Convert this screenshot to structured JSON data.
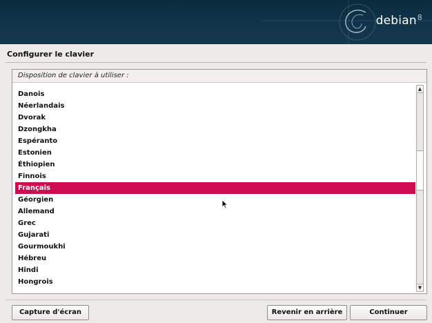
{
  "header": {
    "brand": "debian",
    "version": "8"
  },
  "page": {
    "title": "Configurer le clavier"
  },
  "keyboard_list": {
    "label": "Disposition de clavier à utiliser :",
    "items": [
      "Danois",
      "Néerlandais",
      "Dvorak",
      "Dzongkha",
      "Espéranto",
      "Estonien",
      "Éthiopien",
      "Finnois",
      "Français",
      "Géorgien",
      "Allemand",
      "Grec",
      "Gujarati",
      "Gourmoukhi",
      "Hébreu",
      "Hindi",
      "Hongrois"
    ],
    "selected": "Français",
    "scroll_position": 0.38
  },
  "buttons": {
    "screenshot": "Capture d'écran",
    "back": "Revenir en arrière",
    "continue": "Continuer"
  },
  "colors": {
    "selection": "#cd0d4f",
    "banner": "#0f3247"
  },
  "icons": {
    "scroll_up": "chevron-up-icon",
    "scroll_down": "chevron-down-icon",
    "cursor": "mouse-pointer-icon"
  }
}
